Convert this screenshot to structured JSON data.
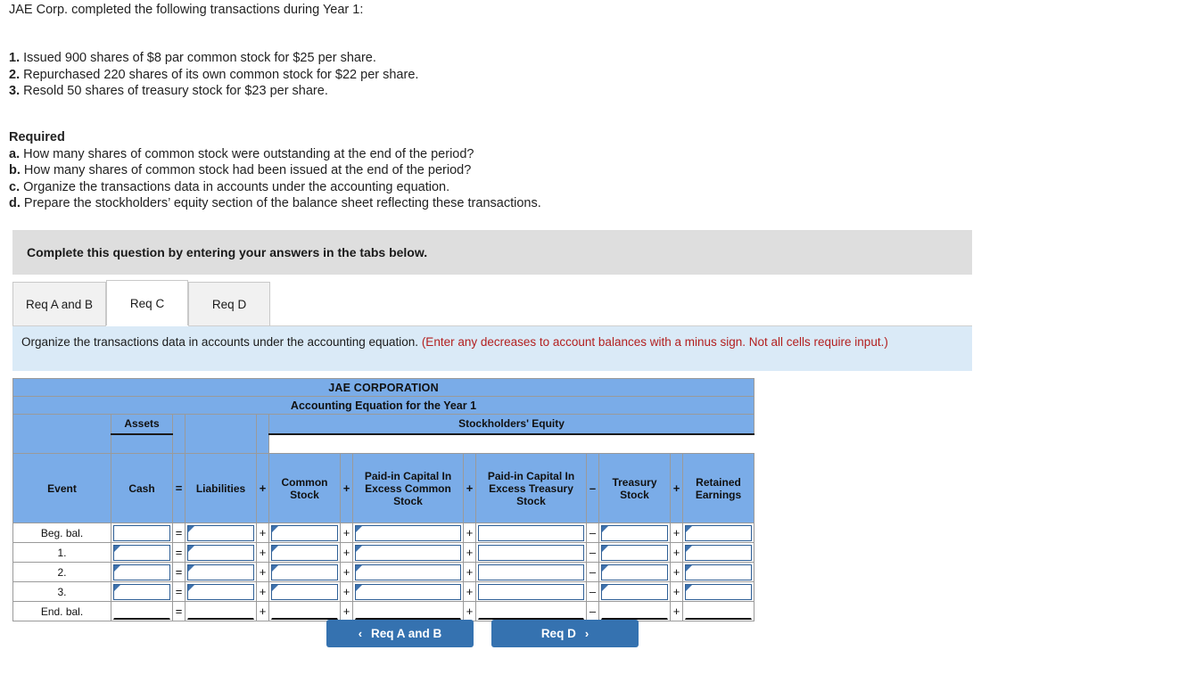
{
  "intro": "JAE Corp. completed the following transactions during Year 1:",
  "transactions": [
    {
      "num": "1.",
      "text": "Issued 900 shares of $8 par common stock for $25 per share."
    },
    {
      "num": "2.",
      "text": "Repurchased 220 shares of its own common stock for $22 per share."
    },
    {
      "num": "3.",
      "text": "Resold 50 shares of treasury stock for $23 per share."
    }
  ],
  "required": {
    "title": "Required",
    "items": [
      {
        "label": "a.",
        "text": "How many shares of common stock were outstanding at the end of the period?"
      },
      {
        "label": "b.",
        "text": "How many shares of common stock had been issued at the end of the period?"
      },
      {
        "label": "c.",
        "text": "Organize the transactions data in accounts under the accounting equation."
      },
      {
        "label": "d.",
        "text": "Prepare the stockholders’ equity section of the balance sheet reflecting these transactions."
      }
    ]
  },
  "banner": "Complete this question by entering your answers in the tabs below.",
  "tabs": [
    {
      "label": "Req A and B",
      "active": false
    },
    {
      "label": "Req C",
      "active": true
    },
    {
      "label": "Req D",
      "active": false
    }
  ],
  "instruction": {
    "main": "Organize the transactions data in accounts under the accounting equation.",
    "hint": "(Enter any decreases to account balances with a minus sign. Not all cells require input.)"
  },
  "table": {
    "title": "JAE CORPORATION",
    "subtitle": "Accounting Equation for the Year 1",
    "group_assets": "Assets",
    "group_equity": "Stockholders' Equity",
    "columns": {
      "event": "Event",
      "cash": "Cash",
      "liabilities": "Liabilities",
      "common_stock": "Common Stock",
      "pic_excess_cs": "Paid-in Capital In Excess Common Stock",
      "pic_excess_ts": "Paid-in Capital In Excess Treasury Stock",
      "treasury_stock": "Treasury Stock",
      "retained_earnings": "Retained Earnings"
    },
    "operators": {
      "equals": "=",
      "plus": "+",
      "minus": "–"
    },
    "rows": [
      {
        "event": "Beg. bal.",
        "cash": "",
        "liabilities": "",
        "common_stock": "",
        "pic_excess_cs": "",
        "pic_excess_ts": "",
        "treasury_stock": "",
        "retained_earnings": ""
      },
      {
        "event": "1.",
        "cash": "",
        "liabilities": "",
        "common_stock": "",
        "pic_excess_cs": "",
        "pic_excess_ts": "",
        "treasury_stock": "",
        "retained_earnings": ""
      },
      {
        "event": "2.",
        "cash": "",
        "liabilities": "",
        "common_stock": "",
        "pic_excess_cs": "",
        "pic_excess_ts": "",
        "treasury_stock": "",
        "retained_earnings": ""
      },
      {
        "event": "3.",
        "cash": "",
        "liabilities": "",
        "common_stock": "",
        "pic_excess_cs": "",
        "pic_excess_ts": "",
        "treasury_stock": "",
        "retained_earnings": ""
      },
      {
        "event": "End. bal.",
        "cash": "",
        "liabilities": "",
        "common_stock": "",
        "pic_excess_cs": "",
        "pic_excess_ts": "",
        "treasury_stock": "",
        "retained_earnings": ""
      }
    ]
  },
  "nav": {
    "prev": {
      "label": "Req A and B",
      "icon": "chevron-left"
    },
    "next": {
      "label": "Req D",
      "icon": "chevron-right"
    }
  },
  "colors": {
    "table_header_blue": "#7aace8",
    "instruction_blue": "#daeaf7",
    "banner_gray": "#dedede",
    "button_blue": "#3572b0",
    "hint_red": "#b32020"
  }
}
